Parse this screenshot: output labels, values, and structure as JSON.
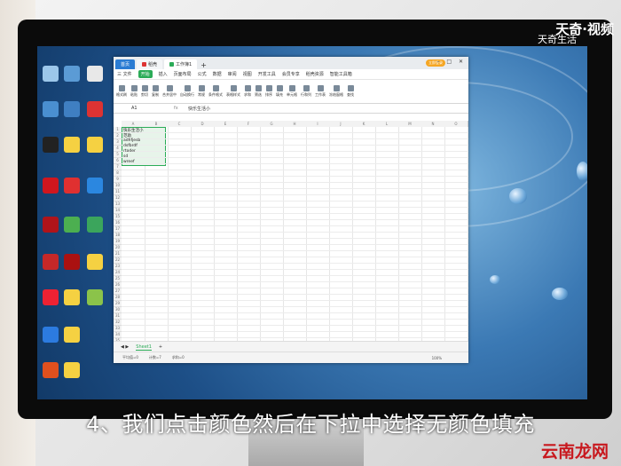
{
  "watermark": {
    "brand": "天奇",
    "sub": "天奇生活",
    "video": "视频"
  },
  "desktop": {
    "icons": [
      "recycle-bin",
      "computer",
      "network",
      "qq",
      "folder",
      "app-red",
      "netease",
      "app-blue",
      "flash",
      "chrome",
      "game",
      "media",
      "app-dark",
      "folder-2",
      "office",
      "code",
      "app-green",
      "folder-3",
      "app-red-2",
      "folder-4"
    ]
  },
  "window": {
    "tabs": [
      {
        "label": "首页"
      },
      {
        "label": "稻壳"
      },
      {
        "label": "工作簿1"
      }
    ],
    "login_label": "立即登录",
    "menu": [
      "三 文件",
      "开始",
      "插入",
      "页面布局",
      "公式",
      "数据",
      "审阅",
      "视图",
      "开发工具",
      "会员专享",
      "稻壳资源",
      "智能工具箱"
    ],
    "active_menu": "开始",
    "ribbon": [
      "格式刷",
      "粘贴",
      "剪切",
      "复制",
      "合并居中",
      "自动换行",
      "常规",
      "条件格式",
      "表格样式",
      "求和",
      "筛选",
      "排序",
      "填充",
      "单元格",
      "行和列",
      "工作表",
      "冻结窗格",
      "查找"
    ],
    "name_box": "A1",
    "fx": "fx",
    "formula_text": "快乐生活小",
    "columns": [
      "A",
      "B",
      "C",
      "D",
      "E",
      "F",
      "G",
      "H",
      "I",
      "J",
      "K",
      "L",
      "M",
      "N",
      "O"
    ],
    "rows": [
      "1",
      "2",
      "3",
      "4",
      "5",
      "6",
      "7",
      "8",
      "9",
      "10",
      "11",
      "12",
      "13",
      "14",
      "15",
      "16",
      "17",
      "18",
      "19",
      "20",
      "21",
      "22",
      "23",
      "24",
      "25",
      "26",
      "27",
      "28",
      "29",
      "30",
      "31",
      "32",
      "33",
      "34",
      "35"
    ],
    "cells": [
      "快乐生活小",
      "范助",
      "adhfjesb",
      "dsfbrdf",
      "rtoder",
      "sd",
      "wreef"
    ],
    "sheet_tab": "Sheet1",
    "status": [
      "平均值=0",
      "计数=7",
      "求和=0"
    ],
    "zoom": "100%"
  },
  "subtitle": "4、我们点击颜色然后在下拉中选择无颜色填充",
  "logo_text": "云南龙网"
}
